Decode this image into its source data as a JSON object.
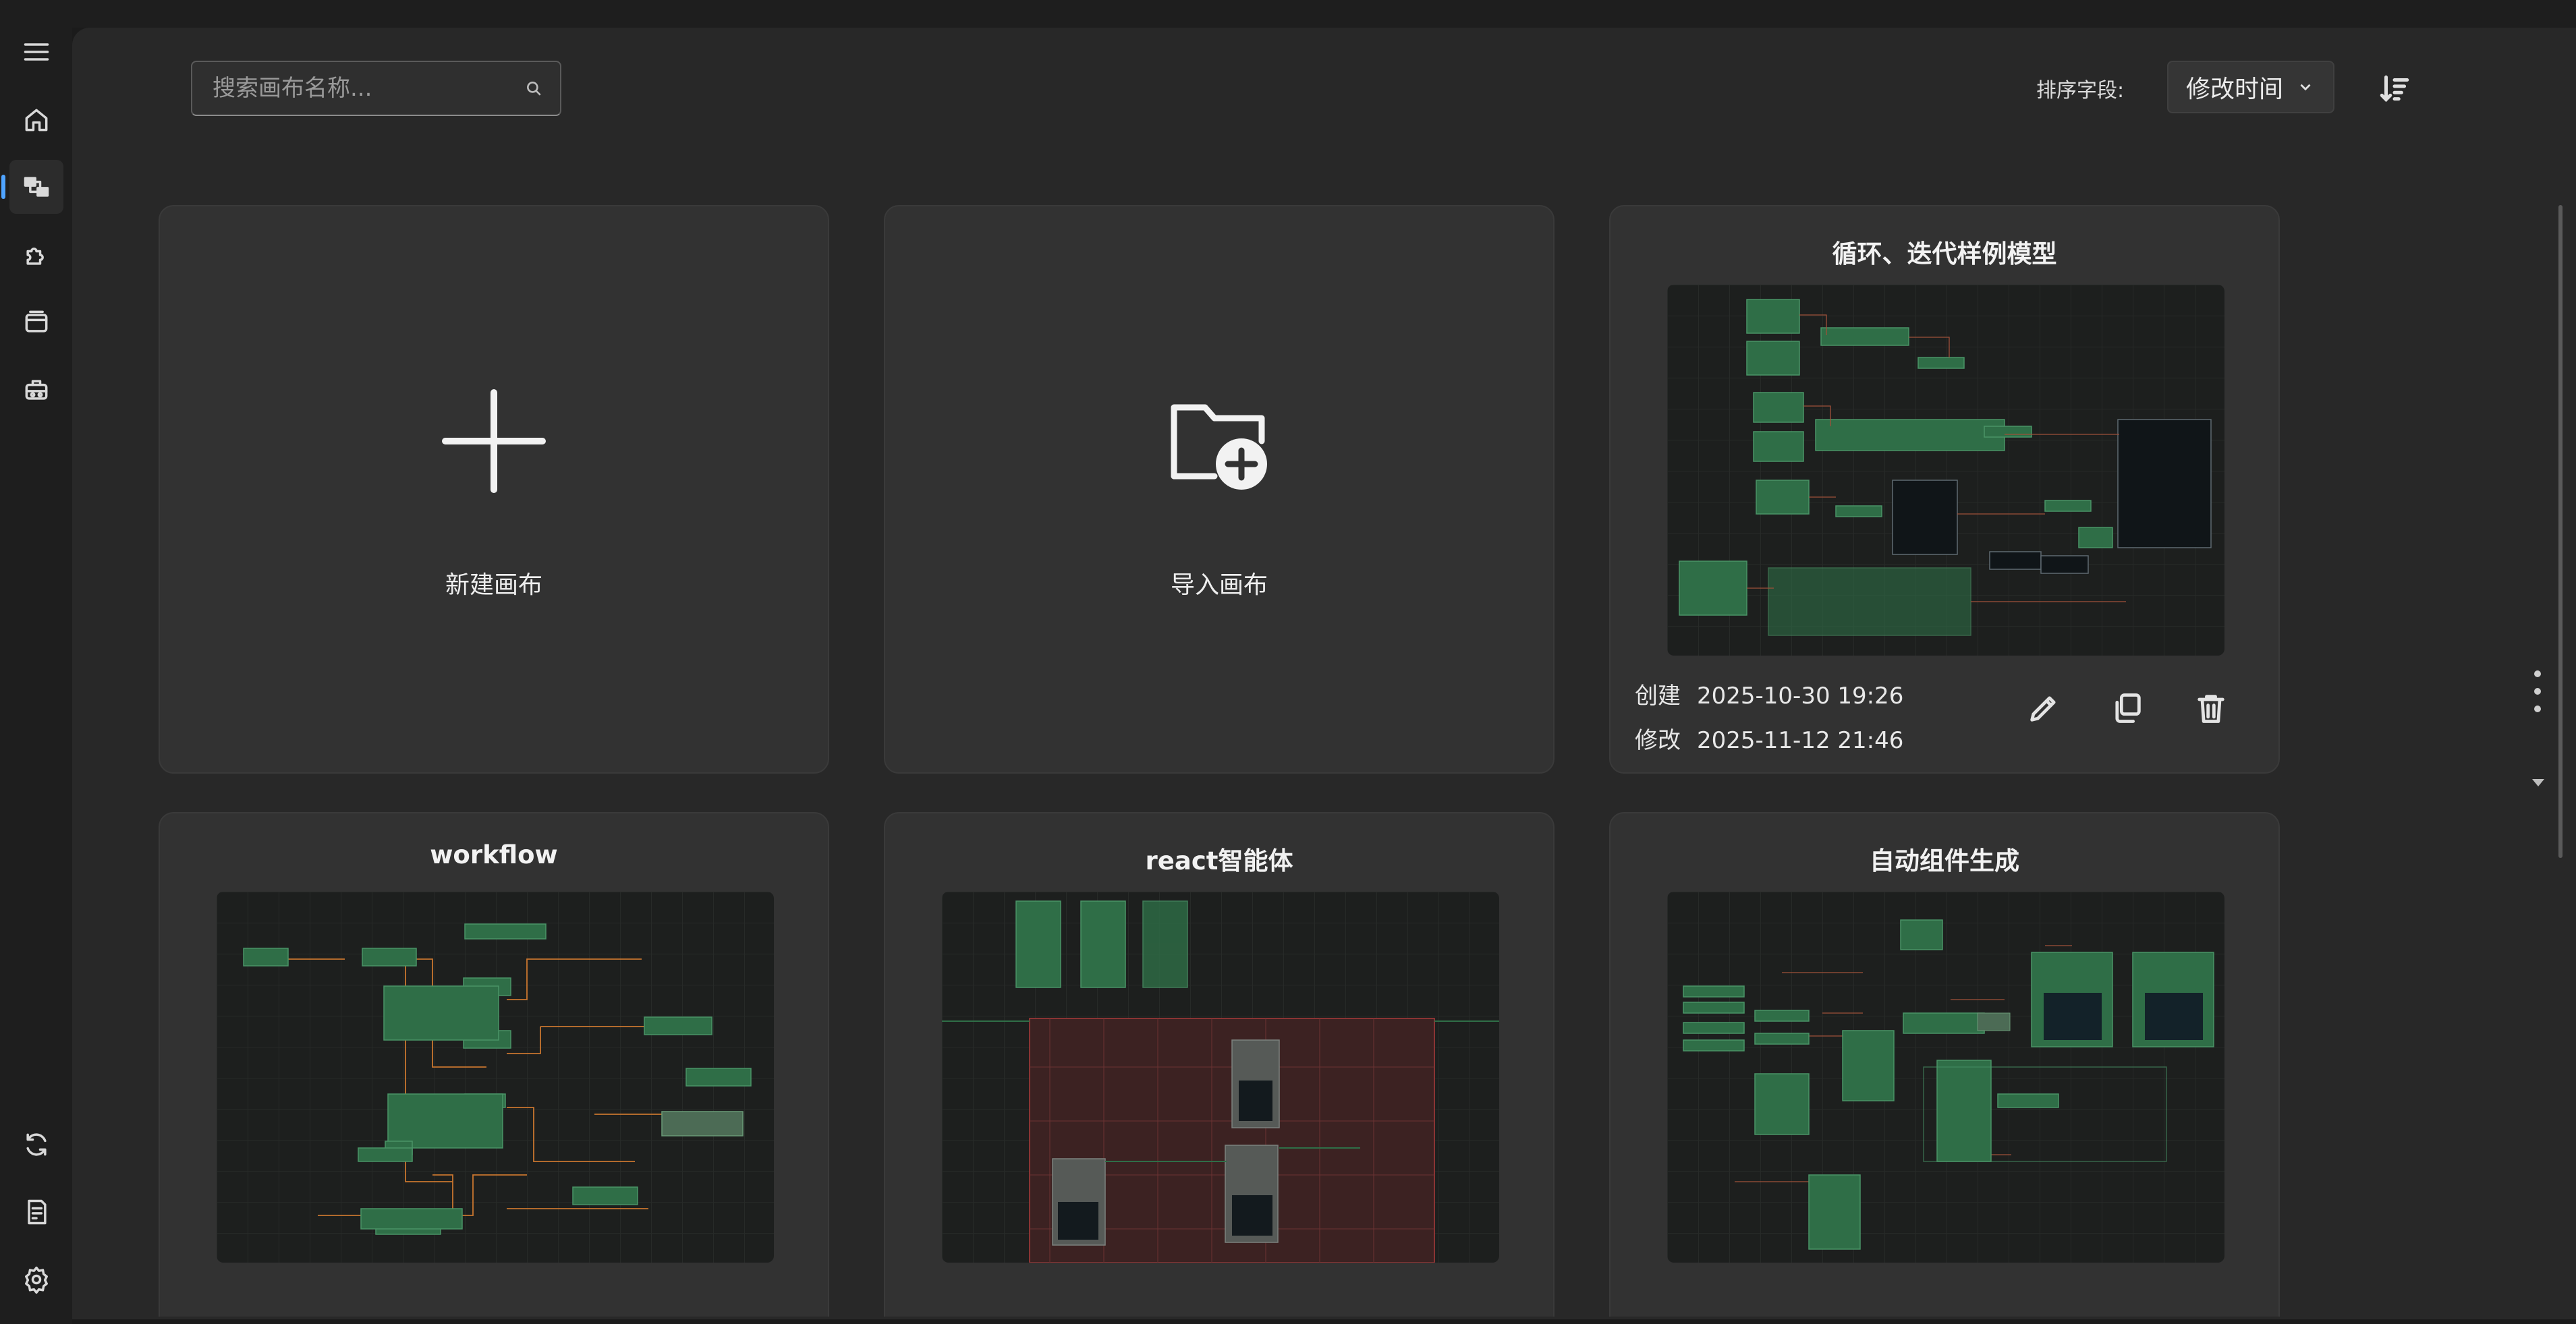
{
  "search": {
    "placeholder": "搜索画布名称..."
  },
  "sort": {
    "label": "排序字段:",
    "selected": "修改时间"
  },
  "actions": {
    "new_label": "新建画布",
    "import_label": "导入画布"
  },
  "meta_labels": {
    "created": "创建",
    "modified": "修改"
  },
  "canvases": [
    {
      "title": "循环、迭代样例模型",
      "created": "2025-10-30 19:26",
      "modified": "2025-11-12 21:46"
    },
    {
      "title": "workflow"
    },
    {
      "title": "react智能体"
    },
    {
      "title": "自动组件生成"
    }
  ],
  "sidebar": {
    "top": [
      "menu-icon",
      "home-icon",
      "canvas-icon",
      "plugin-icon",
      "window-icon",
      "robot-icon"
    ],
    "bottom": [
      "refresh-icon",
      "log-icon",
      "settings-icon"
    ]
  },
  "colors": {
    "accent": "#4ea3ff",
    "node": "#2e6b45",
    "wire": "#c8752f"
  }
}
